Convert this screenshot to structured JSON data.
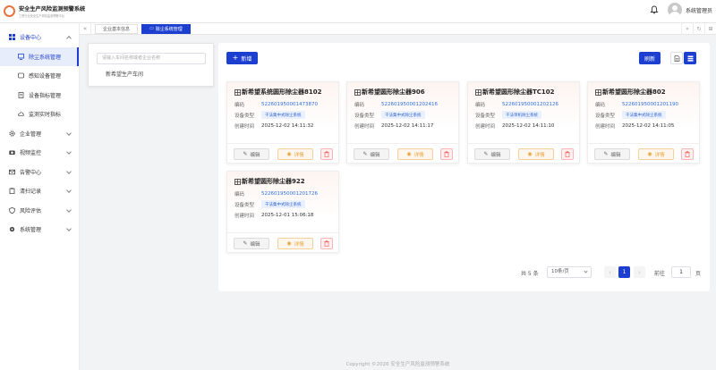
{
  "app": {
    "title": "安全生产风险监测预警系统",
    "subtitle": "工贸行业安全生产风险监测预警平台",
    "username": "系统管理员",
    "copyright": "Copyright ©2026 安全生产风险监测预警系统"
  },
  "sidebar": {
    "items": [
      {
        "label": "设备中心",
        "icon": "grid-icon",
        "state": "open"
      },
      {
        "label": "除尘系统管理",
        "icon": "monitor-icon",
        "state": "active"
      },
      {
        "label": "感知设备管理",
        "icon": "device-icon",
        "state": "sub"
      },
      {
        "label": "设备指标管理",
        "icon": "doc-icon",
        "state": "sub"
      },
      {
        "label": "监测实时指标",
        "icon": "cloud-icon",
        "state": "sub"
      },
      {
        "label": "企业管理",
        "icon": "gear-icon",
        "state": "collapsed"
      },
      {
        "label": "视频监控",
        "icon": "camera-icon",
        "state": "collapsed"
      },
      {
        "label": "告警中心",
        "icon": "mail-icon",
        "state": "collapsed"
      },
      {
        "label": "清扫记录",
        "icon": "clipboard-icon",
        "state": "collapsed"
      },
      {
        "label": "风险评估",
        "icon": "shield-icon",
        "state": "collapsed"
      },
      {
        "label": "系统管理",
        "icon": "settings-icon",
        "state": "collapsed"
      }
    ]
  },
  "tabs": [
    {
      "label": "企业基本信息",
      "active": false
    },
    {
      "label": "除尘系统管理",
      "active": true
    }
  ],
  "tree": {
    "search_placeholder": "请输入车间名称或者企业名称",
    "node": "新希望生产车间"
  },
  "toolbar": {
    "add_label": "新增",
    "refresh_label": "刷新"
  },
  "card_labels": {
    "code": "编码",
    "type": "设备类型",
    "created": "创建时间",
    "edit": "编辑",
    "detail": "详情"
  },
  "cards": [
    {
      "title": "新希望系统圆形除尘器8102",
      "code": "522601950001473870",
      "type": "干法集中式除尘系统",
      "created": "2025-12-02 14:11:32"
    },
    {
      "title": "新希望圆形除尘器906",
      "code": "522601950001202416",
      "type": "干法集中式除尘系统",
      "created": "2025-12-02 14:11:17"
    },
    {
      "title": "新希望圆形除尘器TC102",
      "code": "522601950001202126",
      "type": "干法单机除尘系统",
      "created": "2025-12-02 14:11:10"
    },
    {
      "title": "新希望圆形除尘器802",
      "code": "522601950001201190",
      "type": "干法集中式除尘系统",
      "created": "2025-12-02 14:11:05"
    },
    {
      "title": "新希望圆形除尘器922",
      "code": "522601950001201726",
      "type": "干法集中式除尘系统",
      "created": "2025-12-01 15:06:18"
    }
  ],
  "pagination": {
    "total": "共 5 条",
    "page_size": "10条/页",
    "current": "1",
    "goto_label": "前往",
    "goto_value": "1",
    "unit": "页"
  },
  "colors": {
    "primary": "#1d3fcf",
    "warning": "#e6a23c",
    "danger": "#f56c6c",
    "logo": "#e8733c"
  }
}
